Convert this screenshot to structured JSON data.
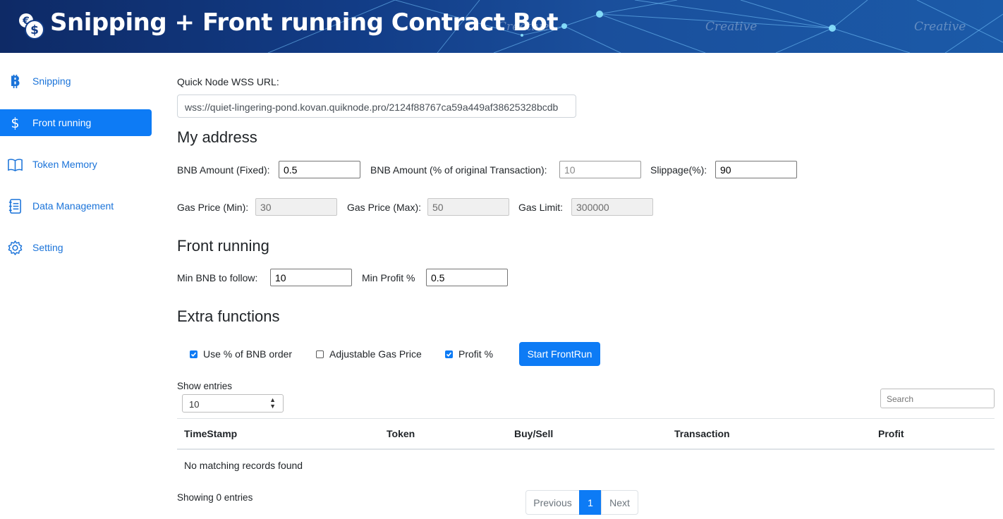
{
  "header": {
    "title": "Snipping + Front running Contract Bot",
    "logo_icon": "coins-dollar-euro-icon",
    "watermark": "Creative"
  },
  "sidebar": {
    "items": [
      {
        "label": "Snipping",
        "icon": "bitcoin-icon",
        "active": false
      },
      {
        "label": "Front running",
        "icon": "dollar-icon",
        "active": true
      },
      {
        "label": "Token Memory",
        "icon": "book-icon",
        "active": false
      },
      {
        "label": "Data Management",
        "icon": "journal-icon",
        "active": false
      },
      {
        "label": "Setting",
        "icon": "gear-icon",
        "active": false
      }
    ]
  },
  "wss": {
    "label": "Quick Node WSS URL:",
    "value": "wss://quiet-lingering-pond.kovan.quiknode.pro/2124f88767ca59a449af38625328bcdb"
  },
  "my_address": {
    "heading": "My address",
    "bnb_fixed_label": "BNB Amount (Fixed):",
    "bnb_fixed_value": "0.5",
    "bnb_pct_label": "BNB Amount (% of original Transaction):",
    "bnb_pct_value": "10",
    "slippage_label": "Slippage(%):",
    "slippage_value": "90",
    "gas_min_label": "Gas Price (Min):",
    "gas_min_value": "30",
    "gas_max_label": "Gas Price (Max):",
    "gas_max_value": "50",
    "gas_limit_label": "Gas Limit:",
    "gas_limit_value": "300000"
  },
  "front_running": {
    "heading": "Front running",
    "min_bnb_label": "Min BNB to follow:",
    "min_bnb_value": "10",
    "min_profit_label": "Min Profit %",
    "min_profit_value": "0.5"
  },
  "extra": {
    "heading": "Extra functions",
    "checkboxes": [
      {
        "label": "Use % of BNB order",
        "checked": true
      },
      {
        "label": "Adjustable Gas Price",
        "checked": false
      },
      {
        "label": "Profit %",
        "checked": true
      }
    ],
    "start_button": "Start FrontRun"
  },
  "table": {
    "show_entries_label": "Show entries",
    "entries_value": "10",
    "search_placeholder": "Search",
    "columns": [
      "TimeStamp",
      "Token",
      "Buy/Sell",
      "Transaction",
      "Profit"
    ],
    "empty_message": "No matching records found",
    "info": "Showing 0 entries"
  },
  "pagination": {
    "previous": "Previous",
    "current": "1",
    "next": "Next"
  },
  "colors": {
    "accent": "#0d7bf5",
    "link": "#1a73d9"
  }
}
